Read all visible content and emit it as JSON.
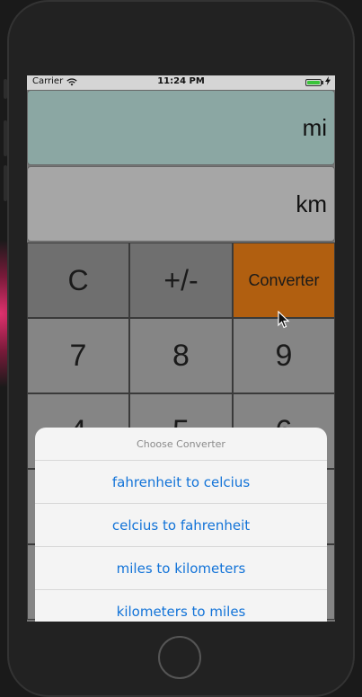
{
  "status_bar": {
    "carrier": "Carrier",
    "wifi_icon": "wifi-icon",
    "time": "11:24 PM",
    "battery_icon": "battery-icon",
    "battery_level": 1.0,
    "charge_icon": "bolt-icon"
  },
  "display": {
    "top_unit": "mi",
    "bottom_unit": "km"
  },
  "keys": {
    "clear": "C",
    "sign": "+/-",
    "converter": "Converter",
    "seven": "7",
    "eight": "8",
    "nine": "9",
    "four": "4",
    "five": "5",
    "six": "6"
  },
  "colors": {
    "top_display": "#8ba7a3",
    "bottom_display": "#a6a6a6",
    "accent_key": "#b15f10",
    "sheet_option_text": "#1273d8"
  },
  "action_sheet": {
    "title": "Choose Converter",
    "options": [
      "fahrenheit to celcius",
      "celcius to fahrenheit",
      "miles to kilometers",
      "kilometers to miles"
    ]
  }
}
